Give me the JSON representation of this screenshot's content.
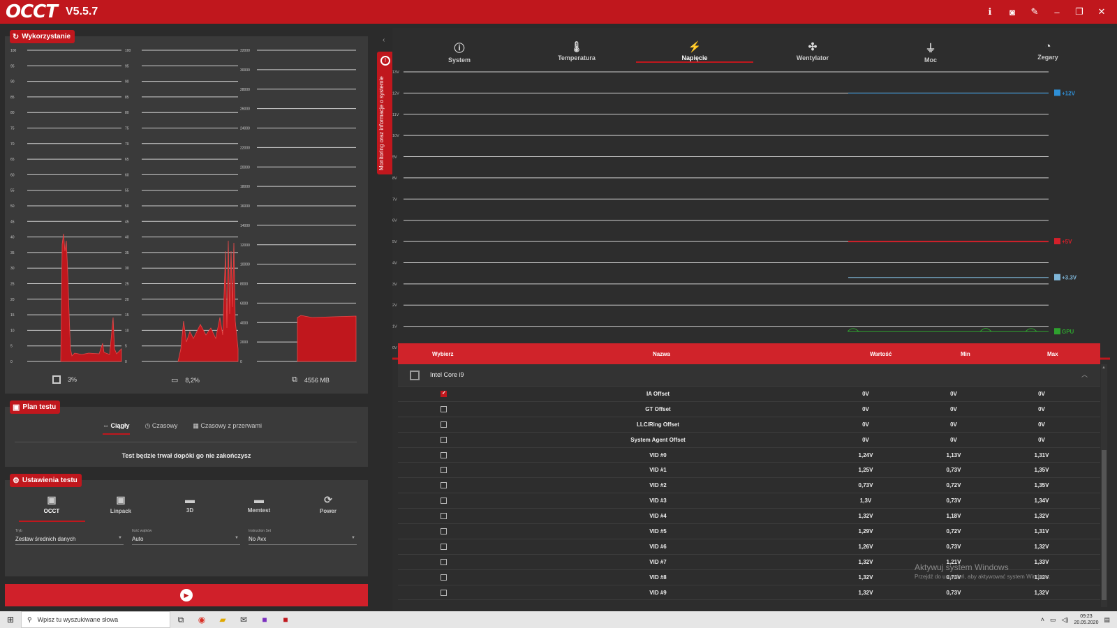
{
  "app": {
    "logo": "OCCT",
    "version": "V5.5.7"
  },
  "titlebar_icons": [
    "info-icon",
    "camera-icon",
    "wrench-icon",
    "minimize-icon",
    "restore-icon",
    "close-icon"
  ],
  "usage_panel": {
    "tag": "Wykorzystanie",
    "charts": [
      {
        "label": "3%",
        "icon": "cpu-icon",
        "yticks": [
          "100",
          "95",
          "90",
          "85",
          "80",
          "75",
          "70",
          "65",
          "60",
          "55",
          "50",
          "45",
          "40",
          "35",
          "30",
          "25",
          "20",
          "15",
          "10",
          "5",
          "0"
        ]
      },
      {
        "label": "8,2%",
        "icon": "gpu-icon",
        "yticks": [
          "100",
          "95",
          "90",
          "85",
          "80",
          "75",
          "70",
          "65",
          "60",
          "55",
          "50",
          "45",
          "40",
          "35",
          "30",
          "25",
          "20",
          "15",
          "10",
          "5",
          "0"
        ]
      },
      {
        "label": "4556 MB",
        "icon": "memory-icon",
        "yticks": [
          "32000",
          "30000",
          "28000",
          "26000",
          "24000",
          "22000",
          "20000",
          "18000",
          "16000",
          "14000",
          "12000",
          "10000",
          "8000",
          "6000",
          "4000",
          "2000",
          "0"
        ]
      }
    ]
  },
  "plan_panel": {
    "tag": "Plan testu",
    "tabs": [
      "Ciągły",
      "Czasowy",
      "Czasowy z przerwami"
    ],
    "message": "Test będzie trwał dopóki go nie zakończysz"
  },
  "settings_panel": {
    "tag": "Ustawienia testu",
    "tabs": [
      "OCCT",
      "Linpack",
      "3D",
      "Memtest",
      "Power"
    ],
    "fields": [
      {
        "label": "Tryb",
        "value": "Zestaw średnich danych"
      },
      {
        "label": "Ilość wątków",
        "value": "Auto"
      },
      {
        "label": "Instruction Set",
        "value": "No Avx"
      }
    ]
  },
  "side_tab": {
    "label": "Monitoring oraz informacje o systemie"
  },
  "monitor_tabs": [
    "System",
    "Temperatura",
    "Napięcie",
    "Wentylator",
    "Moc",
    "Zegary"
  ],
  "volt_chart": {
    "yticks": [
      "13V",
      "12V",
      "11V",
      "10V",
      "9V",
      "8V",
      "7V",
      "6V",
      "5V",
      "4V",
      "3V",
      "2V",
      "1V",
      "0V"
    ],
    "legend": [
      "+12V",
      "+5V",
      "+3.3V",
      "GPU",
      "IA Offset"
    ],
    "colors": {
      "v12": "#2e8fd6",
      "v5": "#d3202a",
      "v33": "#7fb6d8",
      "gpu": "#2ea02e",
      "ia": "#ffffff"
    }
  },
  "chart_data": {
    "type": "line",
    "title": "",
    "xlabel": "",
    "ylabel": "",
    "ylim": [
      0,
      13
    ],
    "series": [
      {
        "name": "+12V",
        "values": [
          12.0,
          12.0,
          12.0,
          12.0,
          12.0
        ]
      },
      {
        "name": "+5V",
        "values": [
          5.0,
          5.0,
          5.0,
          5.0,
          5.0
        ]
      },
      {
        "name": "+3.3V",
        "values": [
          3.3,
          3.3,
          3.3,
          3.3,
          3.3
        ]
      },
      {
        "name": "GPU",
        "values": [
          0.75,
          0.75,
          0.75,
          0.75,
          0.75
        ]
      },
      {
        "name": "IA Offset",
        "values": [
          0,
          0,
          0,
          0,
          0
        ]
      }
    ]
  },
  "table": {
    "headers": [
      "Wybierz",
      "Nazwa",
      "Wartość",
      "Min",
      "Max"
    ],
    "group": "Intel Core i9",
    "rows": [
      {
        "checked": true,
        "name": "IA Offset",
        "value": "0V",
        "min": "0V",
        "max": "0V"
      },
      {
        "checked": false,
        "name": "GT Offset",
        "value": "0V",
        "min": "0V",
        "max": "0V"
      },
      {
        "checked": false,
        "name": "LLC/Ring Offset",
        "value": "0V",
        "min": "0V",
        "max": "0V"
      },
      {
        "checked": false,
        "name": "System Agent Offset",
        "value": "0V",
        "min": "0V",
        "max": "0V"
      },
      {
        "checked": false,
        "name": "VID #0",
        "value": "1,24V",
        "min": "1,13V",
        "max": "1,31V"
      },
      {
        "checked": false,
        "name": "VID #1",
        "value": "1,25V",
        "min": "0,73V",
        "max": "1,35V"
      },
      {
        "checked": false,
        "name": "VID #2",
        "value": "0,73V",
        "min": "0,72V",
        "max": "1,35V"
      },
      {
        "checked": false,
        "name": "VID #3",
        "value": "1,3V",
        "min": "0,73V",
        "max": "1,34V"
      },
      {
        "checked": false,
        "name": "VID #4",
        "value": "1,32V",
        "min": "1,18V",
        "max": "1,32V"
      },
      {
        "checked": false,
        "name": "VID #5",
        "value": "1,29V",
        "min": "0,72V",
        "max": "1,31V"
      },
      {
        "checked": false,
        "name": "VID #6",
        "value": "1,26V",
        "min": "0,73V",
        "max": "1,32V"
      },
      {
        "checked": false,
        "name": "VID #7",
        "value": "1,32V",
        "min": "1,21V",
        "max": "1,33V"
      },
      {
        "checked": false,
        "name": "VID #8",
        "value": "1,32V",
        "min": "0,73V",
        "max": "1,32V"
      },
      {
        "checked": false,
        "name": "VID #9",
        "value": "1,32V",
        "min": "0,73V",
        "max": "1,32V"
      }
    ]
  },
  "watermark": {
    "line1": "Aktywuj system Windows",
    "line2": "Przejdź do ustawień, aby aktywować system Windows."
  },
  "taskbar": {
    "search_placeholder": "Wpisz tu wyszukiwane słowa",
    "time": "09:23",
    "date": "20.05.2020"
  }
}
